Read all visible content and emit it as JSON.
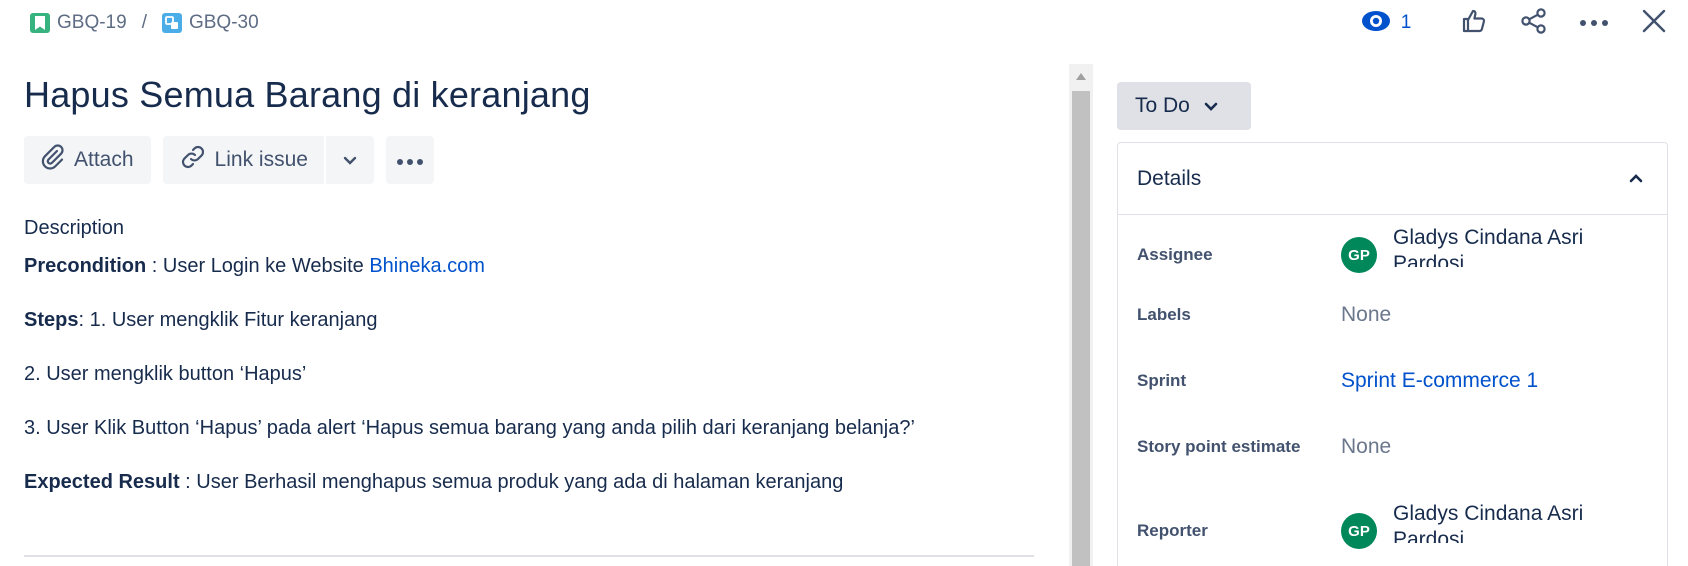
{
  "breadcrumb": {
    "parent": "GBQ-19",
    "separator": "/",
    "current": "GBQ-30"
  },
  "top_actions": {
    "watch_count": "1"
  },
  "issue": {
    "title": "Hapus Semua Barang di keranjang"
  },
  "toolbar": {
    "attach_label": "Attach",
    "link_issue_label": "Link issue"
  },
  "description": {
    "heading": "Description",
    "precondition_label": "Precondition",
    "precondition_text": " : User Login ke Website ",
    "precondition_link": "Bhineka.com",
    "steps_label": "Steps",
    "steps_text": ":  1. User mengklik Fitur keranjang",
    "step2": "2. User mengklik button ‘Hapus’",
    "step3": "3. User Klik Button ‘Hapus’ pada alert ‘Hapus semua barang yang anda pilih dari keranjang belanja?’",
    "expected_label": "Expected Result",
    "expected_text": " : User Berhasil menghapus semua produk yang ada di halaman keranjang"
  },
  "status": {
    "label": "To Do"
  },
  "details": {
    "title": "Details",
    "assignee_label": "Assignee",
    "assignee_initials": "GP",
    "assignee_name": "Gladys Cindana Asri Pardosi",
    "labels_label": "Labels",
    "labels_value": "None",
    "sprint_label": "Sprint",
    "sprint_value": "Sprint E-commerce 1",
    "story_points_label": "Story point estimate",
    "story_points_value": "None",
    "reporter_label": "Reporter",
    "reporter_initials": "GP",
    "reporter_name": "Gladys Cindana Asri Pardosi"
  },
  "colors": {
    "link": "#0052cc",
    "story_icon": "#36b37e",
    "subtask_icon": "#4bade8",
    "avatar": "#00875a",
    "status_button": "#dfe1e6"
  },
  "icons": [
    "story-icon",
    "subtask-icon",
    "eye-icon",
    "thumbs-up-icon",
    "share-icon",
    "more-icon",
    "close-icon",
    "paperclip-icon",
    "link-icon",
    "chevron-down-icon",
    "chevron-up-icon"
  ]
}
